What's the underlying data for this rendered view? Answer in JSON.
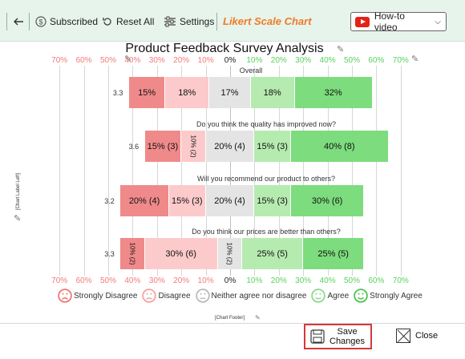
{
  "toolbar": {
    "back_icon": "back-arrow-icon",
    "subscribed_label": "Subscribed",
    "reset_label": "Reset All",
    "settings_label": "Settings",
    "brand": "Likert Scale Chart",
    "howto_label": "How-to video"
  },
  "chart_data": {
    "type": "bar",
    "title": "Product Feedback Survey Analysis",
    "axis_left_ticks": [
      "70%",
      "60%",
      "50%",
      "40%",
      "30%",
      "20%",
      "10%"
    ],
    "axis_zero": "0%",
    "axis_right_ticks": [
      "10%",
      "20%",
      "30%",
      "40%",
      "50%",
      "60%",
      "70%"
    ],
    "categories": [
      "Strongly Disagree",
      "Disagree",
      "Neither agree nor disagree",
      "Agree",
      "Strongly Agree"
    ],
    "rows": [
      {
        "question": "Overall",
        "score": "3.3",
        "values": [
          15,
          18,
          17,
          18,
          32
        ],
        "labels": [
          "15%",
          "18%",
          "17%",
          "18%",
          "32%"
        ]
      },
      {
        "question": "Do you think the quality has improved now?",
        "score": "3.6",
        "values": [
          15,
          10,
          20,
          15,
          40
        ],
        "labels": [
          "15% (3)",
          "10% (2)",
          "20% (4)",
          "15% (3)",
          "40% (8)"
        ]
      },
      {
        "question": "Will you recommend our product to others?",
        "score": "3.2",
        "values": [
          20,
          15,
          20,
          15,
          30
        ],
        "labels": [
          "20% (4)",
          "15% (3)",
          "20% (4)",
          "15% (3)",
          "30% (6)"
        ]
      },
      {
        "question": "Do you think our prices are better than others?",
        "score": "3.3",
        "values": [
          10,
          30,
          10,
          25,
          25
        ],
        "labels": [
          "10% (2)",
          "30% (6)",
          "10% (2)",
          "25% (5)",
          "25% (5)"
        ]
      }
    ],
    "colors": [
      "#f08a8a",
      "#fccaca",
      "#e4e4e4",
      "#b6ebb0",
      "#7ddc7d"
    ],
    "left_label": "[Chart Label Left]",
    "footer_label": "[Chart Footer]"
  },
  "legend": {
    "items": [
      {
        "label": "Strongly Disagree",
        "color": "#f07777",
        "icon": "sad-face-icon"
      },
      {
        "label": "Disagree",
        "color": "#f5a3a3",
        "icon": "frown-face-icon"
      },
      {
        "label": "Neither agree nor disagree",
        "color": "#bbbbbb",
        "icon": "neutral-face-icon"
      },
      {
        "label": "Agree",
        "color": "#8fd88f",
        "icon": "smile-face-icon"
      },
      {
        "label": "Strongly Agree",
        "color": "#4fc44f",
        "icon": "happy-face-icon"
      }
    ]
  },
  "actions": {
    "save_line1": "Save",
    "save_line2": "Changes",
    "close_label": "Close"
  }
}
